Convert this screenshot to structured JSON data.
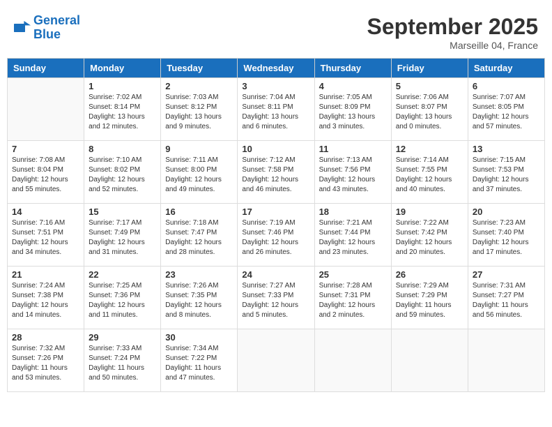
{
  "header": {
    "logo_line1": "General",
    "logo_line2": "Blue",
    "month": "September 2025",
    "location": "Marseille 04, France"
  },
  "weekdays": [
    "Sunday",
    "Monday",
    "Tuesday",
    "Wednesday",
    "Thursday",
    "Friday",
    "Saturday"
  ],
  "weeks": [
    [
      {
        "day": "",
        "info": ""
      },
      {
        "day": "1",
        "info": "Sunrise: 7:02 AM\nSunset: 8:14 PM\nDaylight: 13 hours\nand 12 minutes."
      },
      {
        "day": "2",
        "info": "Sunrise: 7:03 AM\nSunset: 8:12 PM\nDaylight: 13 hours\nand 9 minutes."
      },
      {
        "day": "3",
        "info": "Sunrise: 7:04 AM\nSunset: 8:11 PM\nDaylight: 13 hours\nand 6 minutes."
      },
      {
        "day": "4",
        "info": "Sunrise: 7:05 AM\nSunset: 8:09 PM\nDaylight: 13 hours\nand 3 minutes."
      },
      {
        "day": "5",
        "info": "Sunrise: 7:06 AM\nSunset: 8:07 PM\nDaylight: 13 hours\nand 0 minutes."
      },
      {
        "day": "6",
        "info": "Sunrise: 7:07 AM\nSunset: 8:05 PM\nDaylight: 12 hours\nand 57 minutes."
      }
    ],
    [
      {
        "day": "7",
        "info": "Sunrise: 7:08 AM\nSunset: 8:04 PM\nDaylight: 12 hours\nand 55 minutes."
      },
      {
        "day": "8",
        "info": "Sunrise: 7:10 AM\nSunset: 8:02 PM\nDaylight: 12 hours\nand 52 minutes."
      },
      {
        "day": "9",
        "info": "Sunrise: 7:11 AM\nSunset: 8:00 PM\nDaylight: 12 hours\nand 49 minutes."
      },
      {
        "day": "10",
        "info": "Sunrise: 7:12 AM\nSunset: 7:58 PM\nDaylight: 12 hours\nand 46 minutes."
      },
      {
        "day": "11",
        "info": "Sunrise: 7:13 AM\nSunset: 7:56 PM\nDaylight: 12 hours\nand 43 minutes."
      },
      {
        "day": "12",
        "info": "Sunrise: 7:14 AM\nSunset: 7:55 PM\nDaylight: 12 hours\nand 40 minutes."
      },
      {
        "day": "13",
        "info": "Sunrise: 7:15 AM\nSunset: 7:53 PM\nDaylight: 12 hours\nand 37 minutes."
      }
    ],
    [
      {
        "day": "14",
        "info": "Sunrise: 7:16 AM\nSunset: 7:51 PM\nDaylight: 12 hours\nand 34 minutes."
      },
      {
        "day": "15",
        "info": "Sunrise: 7:17 AM\nSunset: 7:49 PM\nDaylight: 12 hours\nand 31 minutes."
      },
      {
        "day": "16",
        "info": "Sunrise: 7:18 AM\nSunset: 7:47 PM\nDaylight: 12 hours\nand 28 minutes."
      },
      {
        "day": "17",
        "info": "Sunrise: 7:19 AM\nSunset: 7:46 PM\nDaylight: 12 hours\nand 26 minutes."
      },
      {
        "day": "18",
        "info": "Sunrise: 7:21 AM\nSunset: 7:44 PM\nDaylight: 12 hours\nand 23 minutes."
      },
      {
        "day": "19",
        "info": "Sunrise: 7:22 AM\nSunset: 7:42 PM\nDaylight: 12 hours\nand 20 minutes."
      },
      {
        "day": "20",
        "info": "Sunrise: 7:23 AM\nSunset: 7:40 PM\nDaylight: 12 hours\nand 17 minutes."
      }
    ],
    [
      {
        "day": "21",
        "info": "Sunrise: 7:24 AM\nSunset: 7:38 PM\nDaylight: 12 hours\nand 14 minutes."
      },
      {
        "day": "22",
        "info": "Sunrise: 7:25 AM\nSunset: 7:36 PM\nDaylight: 12 hours\nand 11 minutes."
      },
      {
        "day": "23",
        "info": "Sunrise: 7:26 AM\nSunset: 7:35 PM\nDaylight: 12 hours\nand 8 minutes."
      },
      {
        "day": "24",
        "info": "Sunrise: 7:27 AM\nSunset: 7:33 PM\nDaylight: 12 hours\nand 5 minutes."
      },
      {
        "day": "25",
        "info": "Sunrise: 7:28 AM\nSunset: 7:31 PM\nDaylight: 12 hours\nand 2 minutes."
      },
      {
        "day": "26",
        "info": "Sunrise: 7:29 AM\nSunset: 7:29 PM\nDaylight: 11 hours\nand 59 minutes."
      },
      {
        "day": "27",
        "info": "Sunrise: 7:31 AM\nSunset: 7:27 PM\nDaylight: 11 hours\nand 56 minutes."
      }
    ],
    [
      {
        "day": "28",
        "info": "Sunrise: 7:32 AM\nSunset: 7:26 PM\nDaylight: 11 hours\nand 53 minutes."
      },
      {
        "day": "29",
        "info": "Sunrise: 7:33 AM\nSunset: 7:24 PM\nDaylight: 11 hours\nand 50 minutes."
      },
      {
        "day": "30",
        "info": "Sunrise: 7:34 AM\nSunset: 7:22 PM\nDaylight: 11 hours\nand 47 minutes."
      },
      {
        "day": "",
        "info": ""
      },
      {
        "day": "",
        "info": ""
      },
      {
        "day": "",
        "info": ""
      },
      {
        "day": "",
        "info": ""
      }
    ]
  ]
}
